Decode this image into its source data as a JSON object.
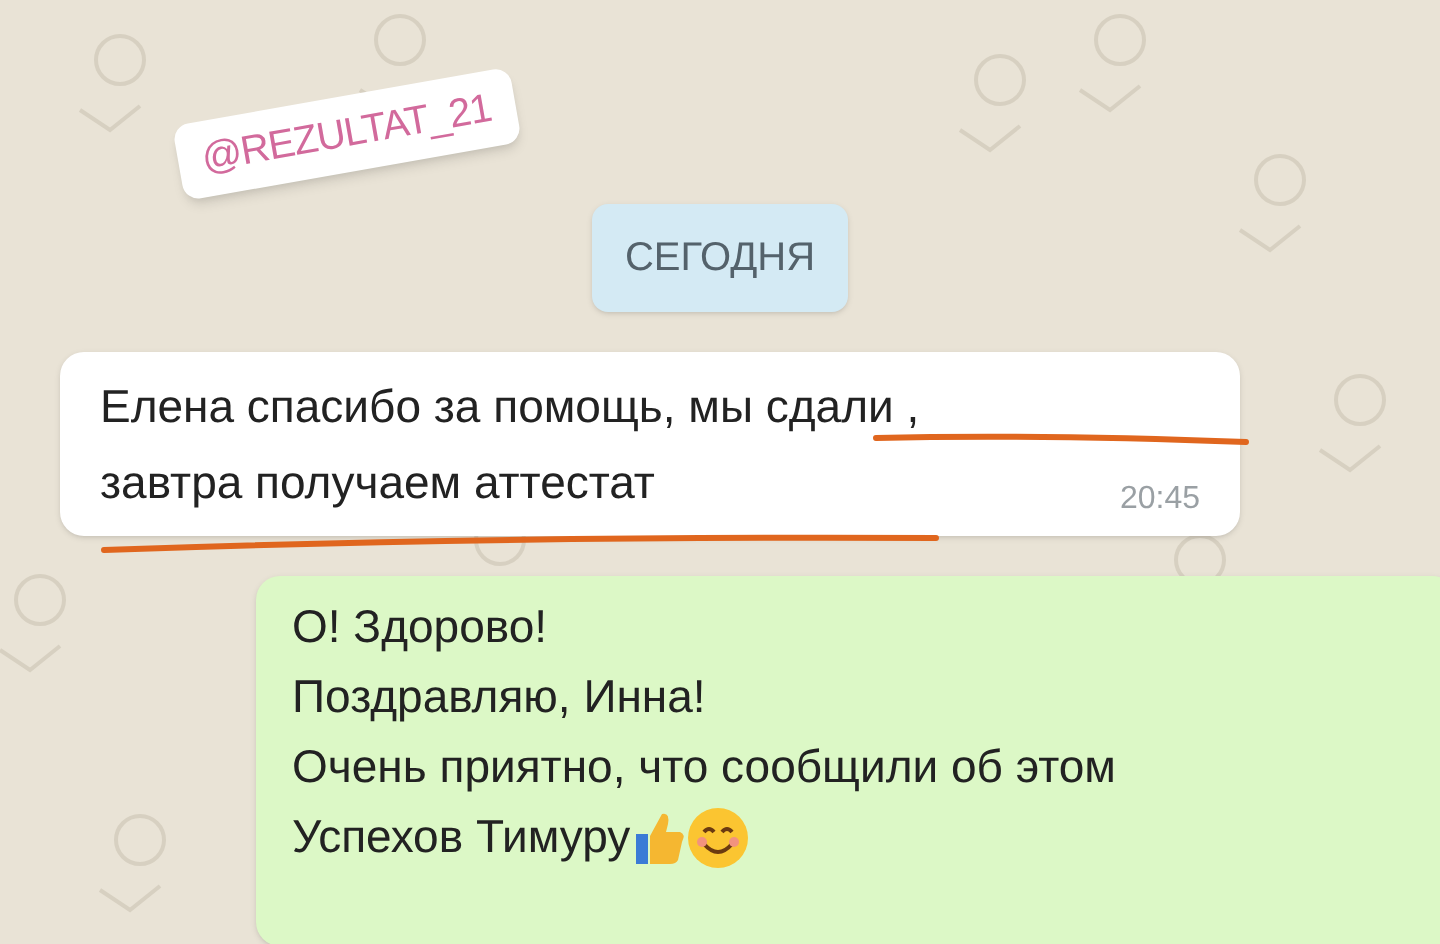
{
  "sticker": {
    "text": "@REZULTAT_21"
  },
  "date_chip": {
    "text": "СЕГОДНЯ"
  },
  "messages": [
    {
      "kind": "incoming",
      "lines": [
        "Елена спасибо за помощь, мы сдали ,",
        "завтра получаем аттестат"
      ],
      "time": "20:45",
      "underlined": true
    },
    {
      "kind": "outgoing",
      "lines": [
        "О! Здорово!",
        "Поздравляю,  Инна!",
        "Очень приятно, что сообщили об этом",
        "Успехов Тимуру"
      ],
      "emoji": true
    }
  ]
}
